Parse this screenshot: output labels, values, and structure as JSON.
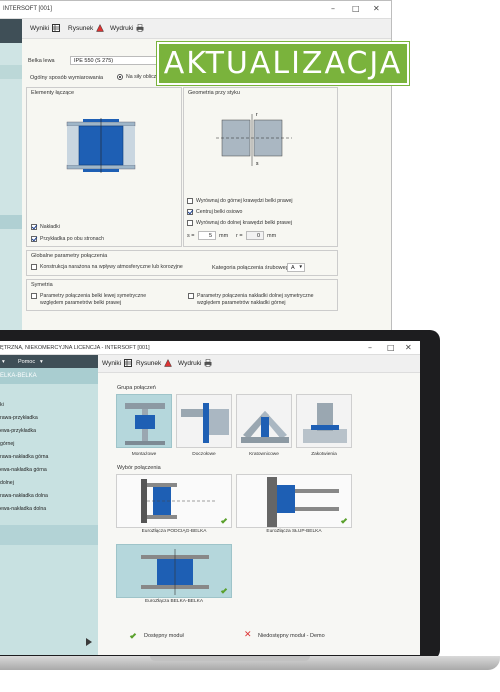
{
  "back_window": {
    "title": "INTERSOFT [001]",
    "toolbar": {
      "results": "Wyniki",
      "drawing": "Rysunek",
      "prints": "Wydruki"
    },
    "beam_label": "Belka lewa",
    "beam_value": "IPE 550 (S 275)",
    "method_label": "Ogólny sposób wymiarowania",
    "method_option": "Na siły obliczeniowe",
    "panel_elements": {
      "title": "Elementy łączące",
      "check_overlays": "Nakładki",
      "check_plates": "Przykładka po obu stronach"
    },
    "panel_geometry": {
      "title": "Geometria przy styku",
      "check_top": "Wyrównaj do górnej krawędzi belki prawej",
      "check_center": "Centruj belki osiowo",
      "check_bottom": "Wyrównaj do dolnej krawędzi belki prawej",
      "s_label": "s =",
      "s_value": "5",
      "s_unit": "mm",
      "r_label": "r =",
      "r_value": "0",
      "r_unit": "mm"
    },
    "panel_global": {
      "title": "Globalne parametry połączenia",
      "check_corrosion": "Konstrukcja narażona na wpływy atmosferyczne lub korozyjne",
      "category_label": "Kategoria połączenia śrubowego",
      "category_value": "A"
    },
    "panel_symmetry": {
      "title": "Symetria",
      "check_left_line1": "Parametry połączenia belki lewej symetryczne",
      "check_left_line2": "względem parametrów belki prawej",
      "check_right_line1": "Parametry połączenia nakładki dolnej symetryczne",
      "check_right_line2": "względem parametrów nakładki górnej"
    }
  },
  "badge": {
    "text": "AKTUALIZACJA"
  },
  "front_window": {
    "title": "ĘTRZNA, NIEKOMERCYJNA LICENCJA - INTERSOFT [001]",
    "menu": {
      "item2": "Pomoc"
    },
    "sidebar_header": "ELKA-BELKA",
    "tree": [
      "ki",
      "rawa-przykładka",
      "ewa-przykładka",
      "górnej",
      "rawa-nakładka górna",
      "ewa-nakładka górna",
      "dolnej",
      "rawa-nakładka dolna",
      "ewa-nakładka dolna"
    ],
    "toolbar": {
      "results": "Wyniki",
      "drawing": "Rysunek",
      "prints": "Wydruki"
    },
    "group_label": "Grupa połączeń",
    "groups": [
      "Montażowe",
      "Doczołowe",
      "Kratownicowe",
      "Zakotwienia"
    ],
    "selection_label": "Wybór połączenia",
    "connections": [
      "EuroZłącza PODCIĄG-BELKA",
      "EuroZłącza SŁUP-BELKA",
      "EuroZłącza BELKA-BELKA"
    ],
    "legend": {
      "available": "Dostępny moduł",
      "unavailable": "Niedostępny moduł - Demo"
    }
  },
  "colors": {
    "accent_green": "#7ab33c",
    "steel_blue": "#1e5fb4",
    "sidebar_teal": "#c8e1e1",
    "header_dark": "#3f4f57"
  }
}
